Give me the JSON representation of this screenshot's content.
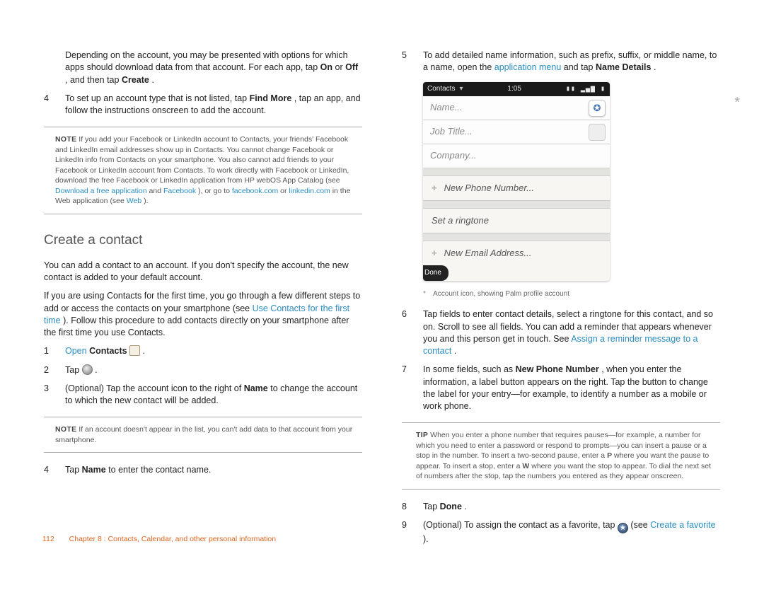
{
  "left": {
    "intro": {
      "full": "Depending on the account, you may be presented with options for which apps should download data from that account. For each app, tap ",
      "on": "On",
      "or": " or ",
      "off": "Off",
      "xthen": ", and then tap ",
      "create": "Create",
      "dot": "."
    },
    "step4": {
      "num": "4",
      "a": "To set up an account type that is not listed, tap ",
      "findmore": "Find More",
      "b": ", tap an app, and follow the instructions onscreen to add the account."
    },
    "note1": {
      "label": "NOTE",
      "a": " If you add your Facebook or LinkedIn account to Contacts, your friends' Facebook and LinkedIn email addresses show up in Contacts. You cannot change Facebook or LinkedIn info from Contacts on your smartphone. You also cannot add friends to your Facebook or LinkedIn account from Contacts. To work directly with Facebook or LinkedIn, download the free Facebook or LinkedIn application from HP webOS App Catalog (see ",
      "dl": "Download a free application",
      "and": " and ",
      "fb": "Facebook",
      "b": "), or go to ",
      "fbc": "facebook.com",
      "or": " or ",
      "lic": "linkedin.com",
      "c": " in the Web application (see ",
      "web": "Web",
      "end": ")."
    },
    "section": "Create a contact",
    "p1": "You can add a contact to an account. If you don't specify the account, the new contact is added to your default account.",
    "p2a": "If you are using Contacts for the first time, you go through a few different steps to add or access the contacts on your smartphone (see ",
    "p2link": "Use Contacts for the first time",
    "p2b": "). Follow this procedure to add contacts directly on your smartphone after the first time you use Contacts.",
    "s1": {
      "num": "1",
      "open": "Open",
      "contacts": " Contacts",
      "dot": " ."
    },
    "s2": {
      "num": "2",
      "tap": "Tap ",
      "dot": " ."
    },
    "s3": {
      "num": "3",
      "a": "(Optional) Tap the account icon to the right of ",
      "name": "Name",
      "b": " to change the account to which the new contact will be added."
    },
    "note2": {
      "label": "NOTE",
      "t": " If an account doesn't appear in the list, you can't add data to that account from your smartphone."
    },
    "s4b": {
      "num": "4",
      "a": "Tap ",
      "name": "Name",
      "b": " to enter the contact name."
    }
  },
  "right": {
    "s5": {
      "num": "5",
      "a": "To add detailed name information, such as prefix, suffix, or middle name, to a name, open the ",
      "appmenu": "application menu",
      "b": " and tap ",
      "namedetails": "Name Details",
      "dot": "."
    },
    "phone": {
      "status_left": "Contacts",
      "status_time": "1:05",
      "name": "Name...",
      "job": "Job Title...",
      "company": "Company...",
      "newphone": "New Phone Number...",
      "ringtone": "Set a ringtone",
      "newemail": "New Email Address...",
      "done": "Done"
    },
    "captionStar": "*",
    "caption": "Account icon, showing Palm profile account",
    "s6": {
      "num": "6",
      "a": "Tap fields to enter contact details, select a ringtone for this contact, and so on. Scroll to see all fields. You can add a reminder that appears whenever you and this person get in touch. See ",
      "link": "Assign a reminder message to a contact",
      "dot": "."
    },
    "s7": {
      "num": "7",
      "a": "In some fields, such as ",
      "npn": "New Phone Number",
      "b": ", when you enter the information, a label button appears on the right. Tap the button to change the label for your entry—for example, to identify a number as a mobile or work phone."
    },
    "tip": {
      "label": "TIP",
      "t": " When you enter a phone number that requires pauses—for example, a number for which you need to enter a password or respond to prompts—you can insert a pause or a stop in the number. To insert a two-second pause, enter a ",
      "p": "P",
      "t2": " where you want the pause to appear. To insert a stop, enter a ",
      "w": "W",
      "t3": " where you want the stop to appear. To dial the next set of numbers after the stop, tap the numbers you entered as they appear onscreen."
    },
    "s8": {
      "num": "8",
      "a": "Tap ",
      "done": "Done",
      "dot": "."
    },
    "s9": {
      "num": "9",
      "a": "(Optional) To assign the contact as a favorite, tap ",
      "b": " (see ",
      "link": "Create a favorite",
      "end": ")."
    }
  },
  "footer": {
    "page": "112",
    "chapter": "Chapter 8 : Contacts, Calendar, and other personal information"
  }
}
